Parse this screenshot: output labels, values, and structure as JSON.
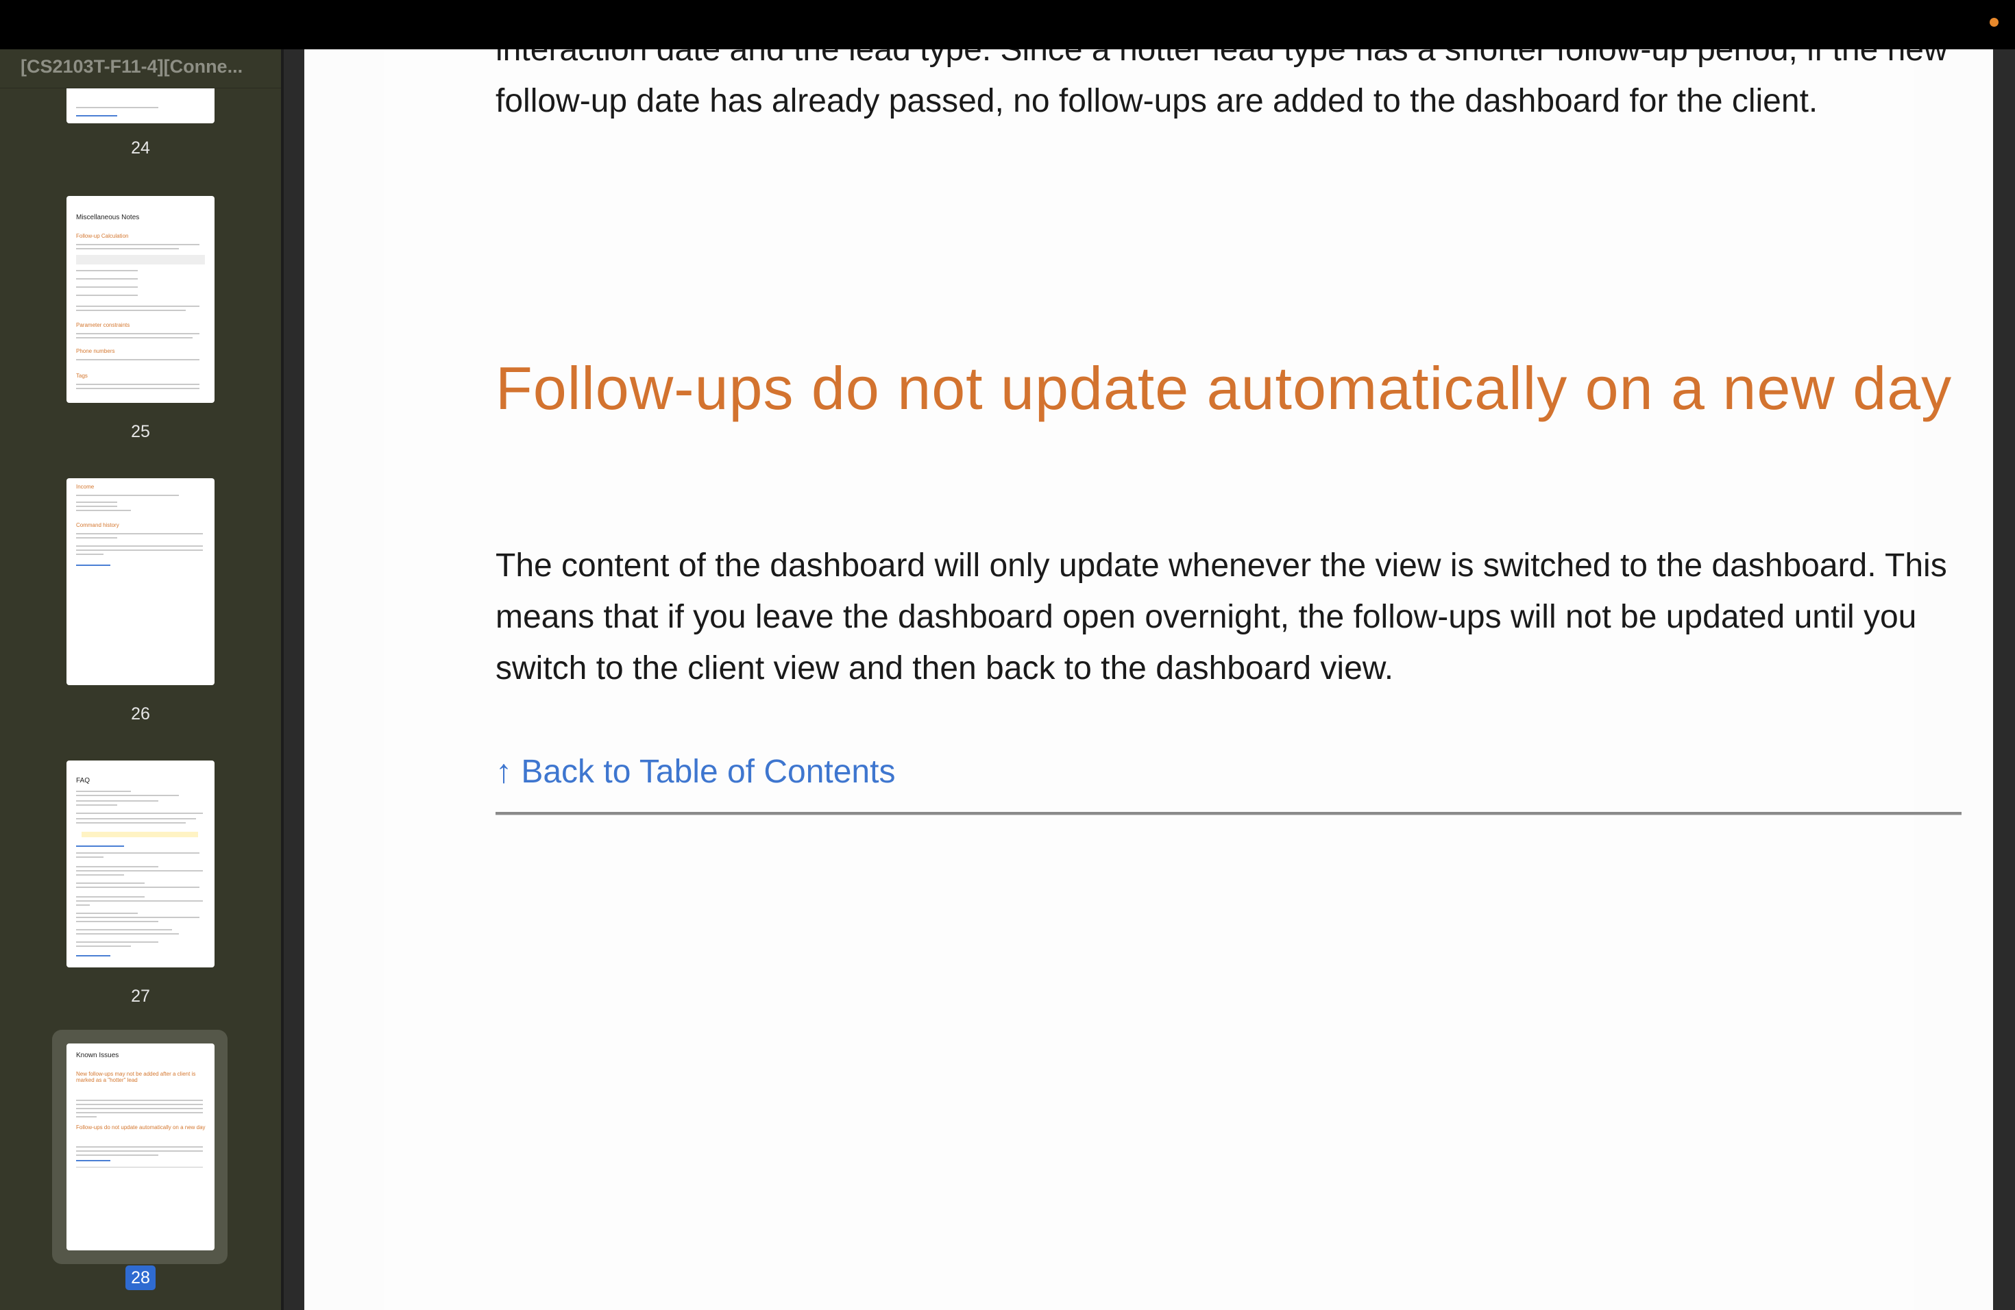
{
  "window": {
    "document_title": "[CS2103T-F11-4][Conne..."
  },
  "sidebar": {
    "pages": [
      {
        "number": "24"
      },
      {
        "number": "25",
        "heading": "Miscellaneous Notes",
        "subheadings": [
          "Follow-up Calculation",
          "Parameter constraints",
          "Phone numbers",
          "Tags"
        ]
      },
      {
        "number": "26",
        "subheadings": [
          "Income",
          "Command history"
        ]
      },
      {
        "number": "27",
        "heading": "FAQ"
      },
      {
        "number": "28",
        "heading": "Known Issues",
        "subheadings": [
          "New follow-ups may not be added after a client is marked as a \"hotter\" lead",
          "Follow-ups do not update automatically on a new day"
        ],
        "selected": true
      }
    ]
  },
  "document": {
    "top_paragraph": "interaction date and the lead type. Since a hotter lead type has a shorter follow-up period, if the new follow-up date has already passed, no follow-ups are added to the dashboard for the client.",
    "heading": "Follow-ups do not update automatically on a new day",
    "body_paragraph": "The content of the dashboard will only update whenever the view is switched to the dashboard. This means that if you leave the dashboard open overnight, the follow-ups will not be updated until you switch to the client view and then back to the dashboard view.",
    "back_link": "↑ Back to Table of Contents"
  },
  "colors": {
    "accent_heading": "#d3732f",
    "link": "#3e76cf",
    "selected_page_badge": "#2f6bd1",
    "status_dot": "#e8892c"
  }
}
